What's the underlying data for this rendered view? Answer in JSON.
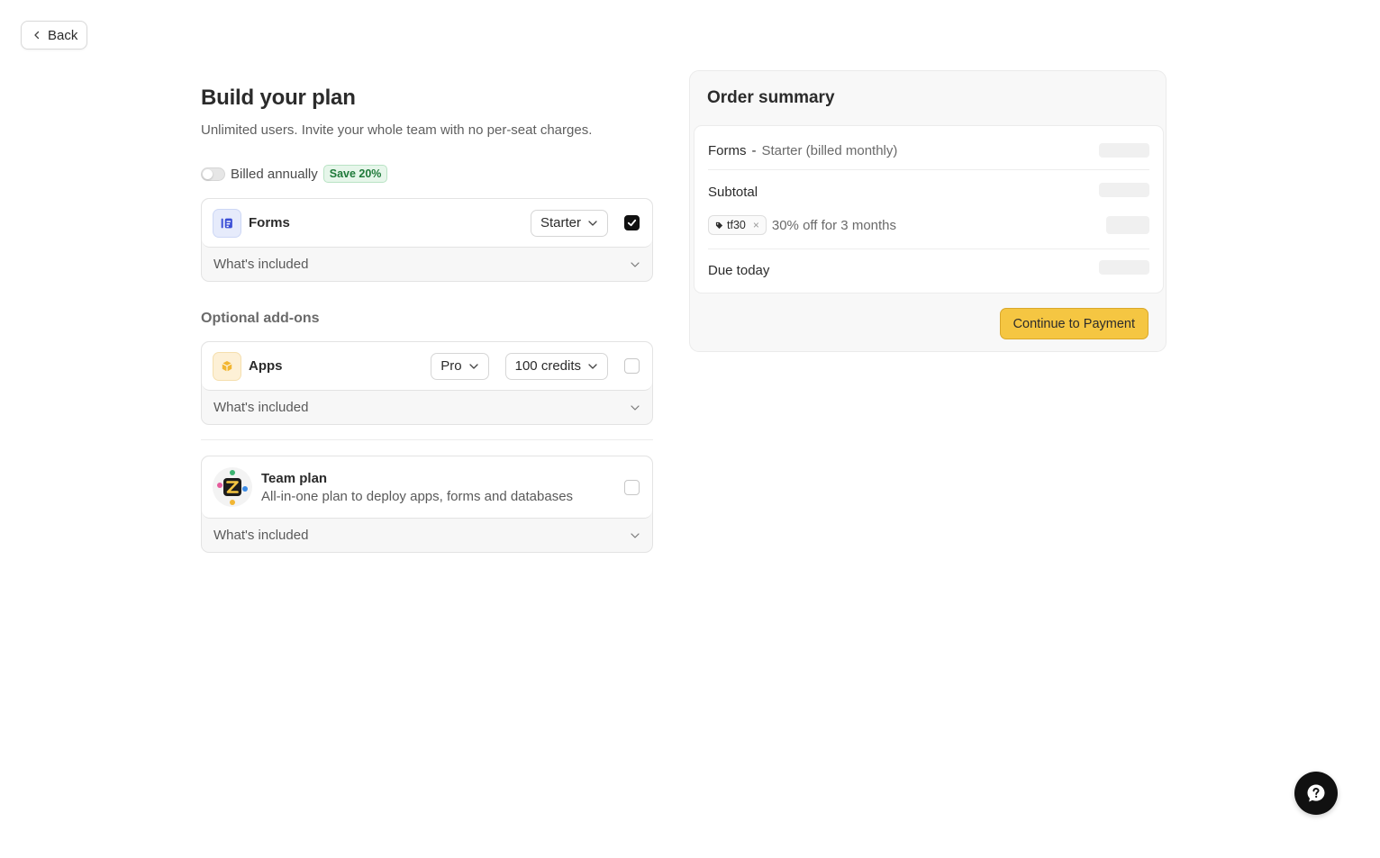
{
  "nav": {
    "back_label": "Back"
  },
  "plan": {
    "title": "Build your plan",
    "subtitle": "Unlimited users. Invite your whole team with no per-seat charges.",
    "billing_label": "Billed annually",
    "billing_annual_on": false,
    "save_badge": "Save 20%",
    "included_label": "What's included"
  },
  "products": {
    "forms": {
      "name": "Forms",
      "tier": "Starter",
      "checked": true,
      "icon": "forms-icon"
    },
    "addons_title": "Optional add-ons",
    "apps": {
      "name": "Apps",
      "tier": "Pro",
      "credits": "100 credits",
      "checked": false,
      "icon": "apps-box-icon"
    },
    "team": {
      "name": "Team plan",
      "description": "All-in-one plan to deploy apps, forms and databases",
      "checked": false,
      "icon": "team-plan-logo"
    }
  },
  "summary": {
    "title": "Order summary",
    "line_item_product": "Forms",
    "line_item_sep": "-",
    "line_item_detail": "Starter (billed monthly)",
    "subtotal_label": "Subtotal",
    "coupon_code": "tf30",
    "coupon_description": "30% off for 3 months",
    "due_today_label": "Due today",
    "pay_button": "Continue to Payment"
  },
  "colors": {
    "accent_yellow": "#f5c642",
    "save_green": "#1f7a3a",
    "checkbox_checked": "#111111"
  }
}
